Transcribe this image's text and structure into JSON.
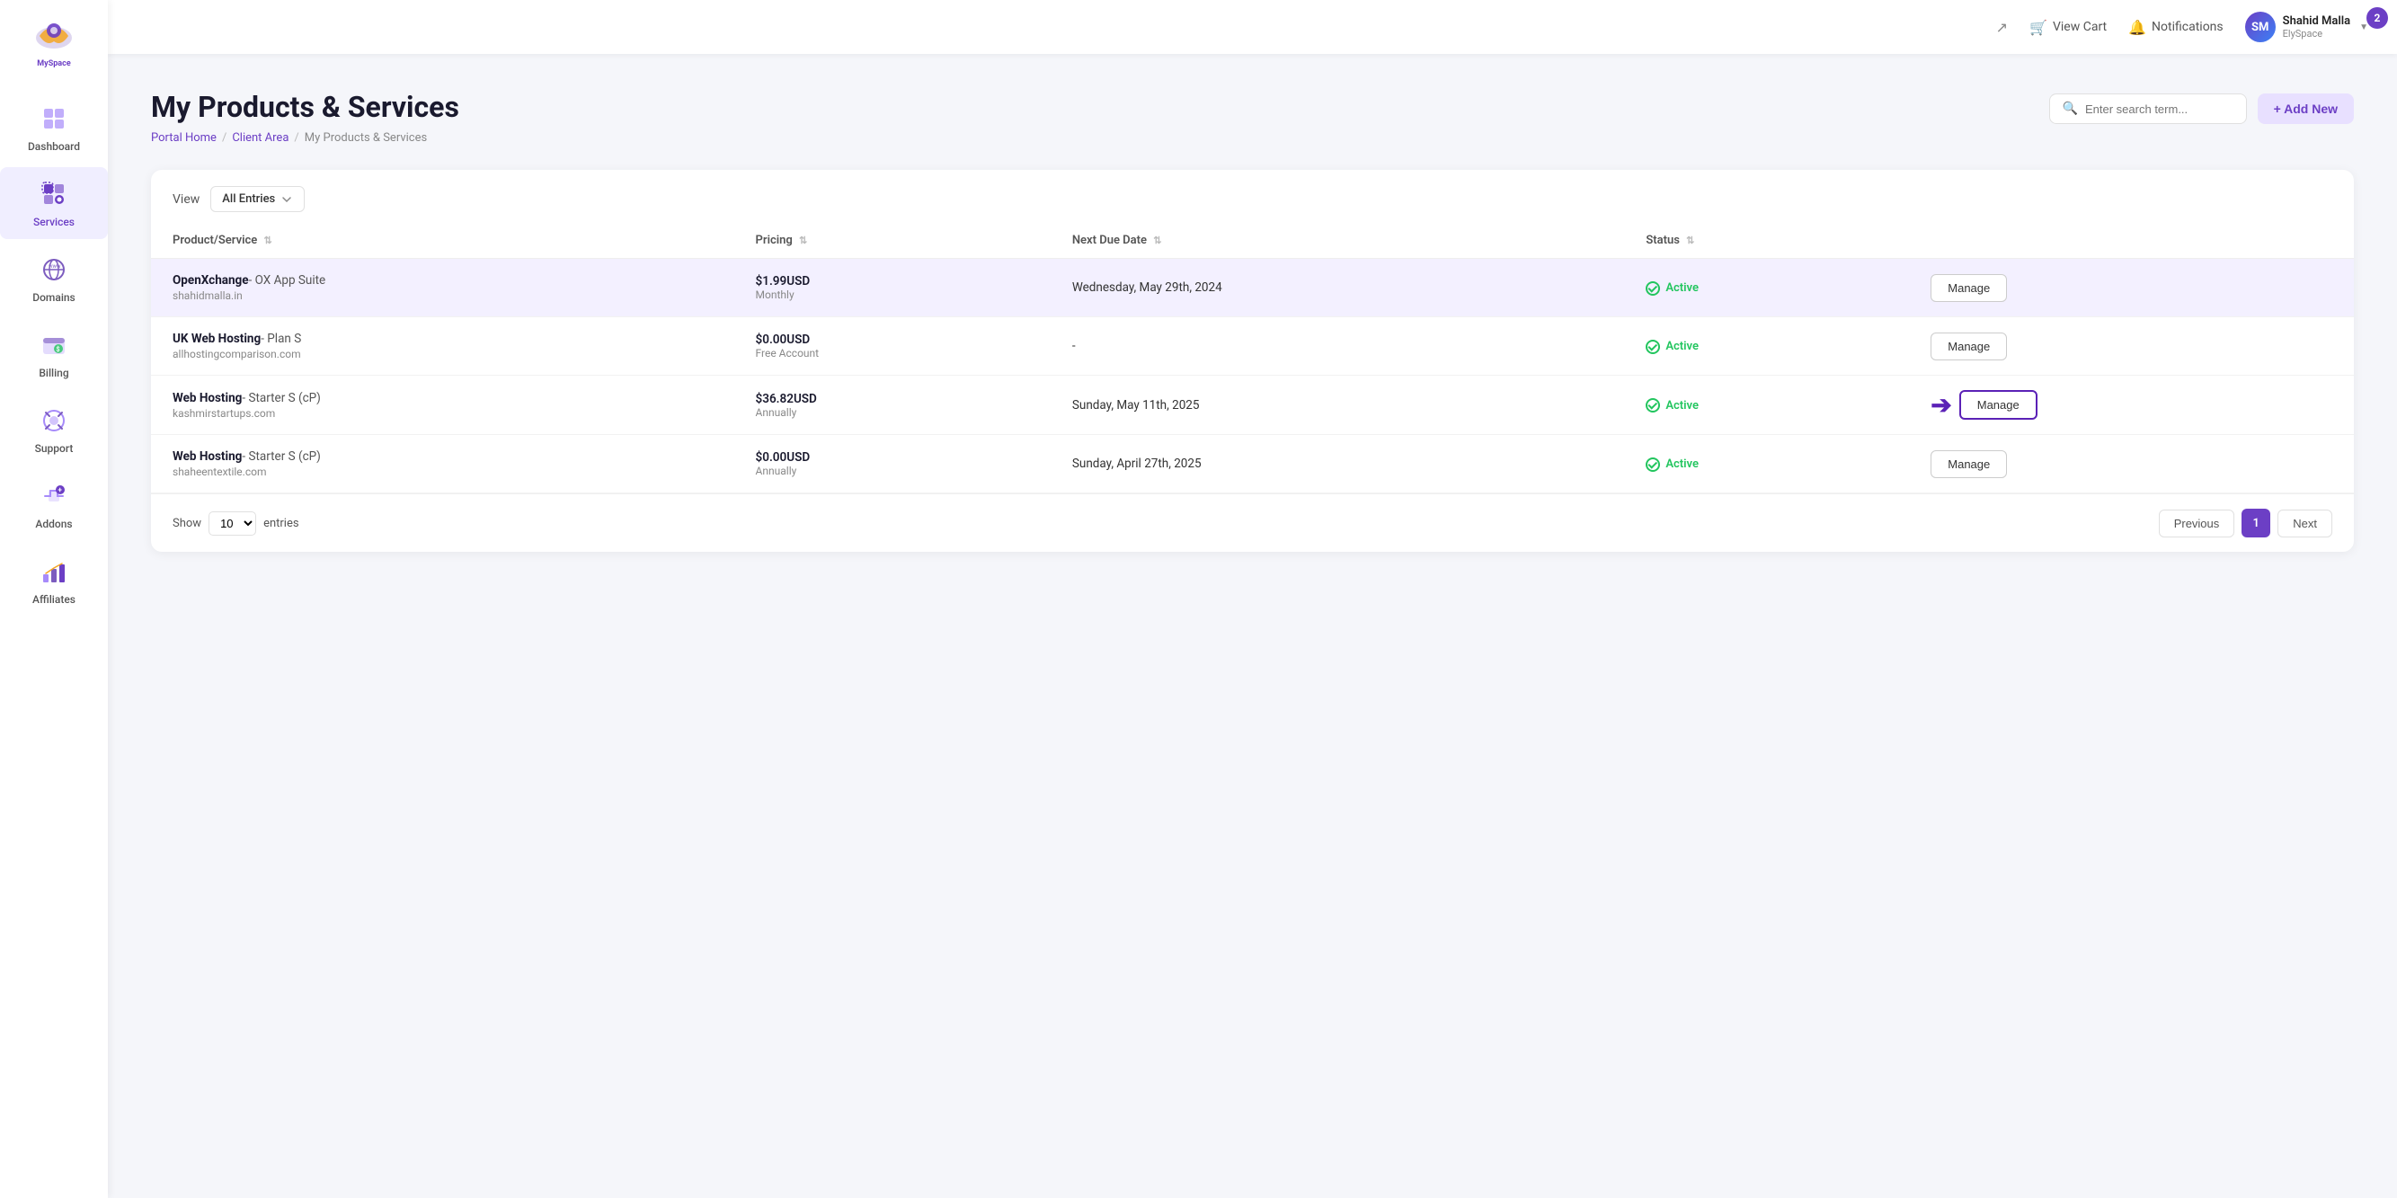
{
  "sidebar": {
    "logo_text": "MySpace",
    "items": [
      {
        "id": "dashboard",
        "label": "Dashboard",
        "active": false
      },
      {
        "id": "services",
        "label": "Services",
        "active": true
      },
      {
        "id": "domains",
        "label": "Domains",
        "active": false
      },
      {
        "id": "billing",
        "label": "Billing",
        "active": false
      },
      {
        "id": "support",
        "label": "Support",
        "active": false
      },
      {
        "id": "addons",
        "label": "Addons",
        "active": false
      },
      {
        "id": "affiliates",
        "label": "Affiliates",
        "active": false
      }
    ]
  },
  "topbar": {
    "view_cart": "View Cart",
    "notifications": "Notifications",
    "user_name": "Shahid Malla",
    "user_sub": "ElySpace",
    "badge_count": "2"
  },
  "page": {
    "title": "My Products & Services",
    "breadcrumb": [
      {
        "label": "Portal Home",
        "href": "#"
      },
      {
        "label": "Client Area",
        "href": "#"
      },
      {
        "label": "My Products & Services",
        "href": "#"
      }
    ],
    "search_placeholder": "Enter search term...",
    "add_new_label": "+ Add New"
  },
  "table": {
    "view_label": "View",
    "view_option": "All Entries",
    "columns": [
      {
        "key": "product",
        "label": "Product/Service"
      },
      {
        "key": "pricing",
        "label": "Pricing"
      },
      {
        "key": "due_date",
        "label": "Next Due Date"
      },
      {
        "key": "status",
        "label": "Status"
      }
    ],
    "rows": [
      {
        "id": 1,
        "product_name": "OpenXchange",
        "product_detail": "- OX App Suite",
        "product_domain": "shahidmalla.in",
        "price": "$1.99USD",
        "period": "Monthly",
        "due_date": "Wednesday, May 29th, 2024",
        "status": "Active",
        "manage_label": "Manage",
        "highlighted": true,
        "has_arrow": false
      },
      {
        "id": 2,
        "product_name": "UK Web Hosting",
        "product_detail": "- Plan S",
        "product_domain": "allhostingcomparison.com",
        "price": "$0.00USD",
        "period": "Free Account",
        "due_date": "-",
        "status": "Active",
        "manage_label": "Manage",
        "highlighted": false,
        "has_arrow": false
      },
      {
        "id": 3,
        "product_name": "Web Hosting",
        "product_detail": "- Starter S (cP)",
        "product_domain": "kashmirstartups.com",
        "price": "$36.82USD",
        "period": "Annually",
        "due_date": "Sunday, May 11th, 2025",
        "status": "Active",
        "manage_label": "Manage",
        "highlighted": false,
        "has_arrow": true
      },
      {
        "id": 4,
        "product_name": "Web Hosting",
        "product_detail": "- Starter S (cP)",
        "product_domain": "shaheentextile.com",
        "price": "$0.00USD",
        "period": "Annually",
        "due_date": "Sunday, April 27th, 2025",
        "status": "Active",
        "manage_label": "Manage",
        "highlighted": false,
        "has_arrow": false
      }
    ],
    "show_label": "Show",
    "entries_label": "entries",
    "show_count": "10",
    "pagination": {
      "previous_label": "Previous",
      "next_label": "Next",
      "current_page": "1"
    }
  }
}
